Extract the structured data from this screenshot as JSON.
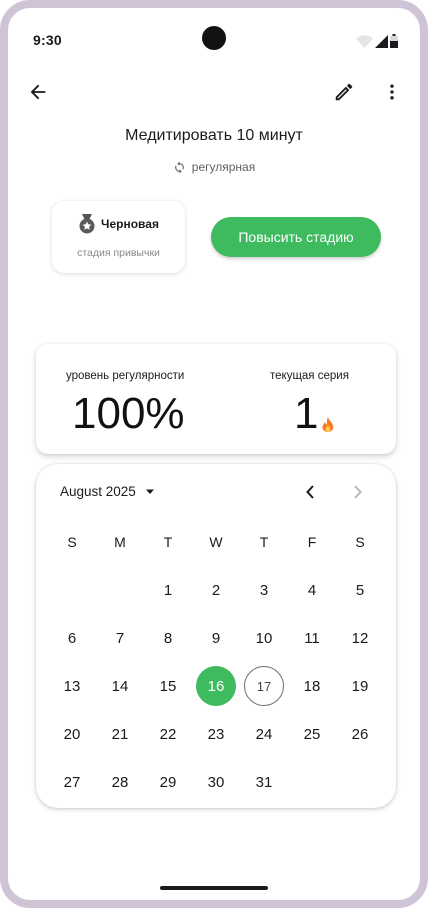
{
  "status_bar": {
    "time": "9:30"
  },
  "habit": {
    "title": "Медитировать 10 минут",
    "frequency": "регулярная"
  },
  "stage": {
    "name": "Черновая",
    "caption": "стадия привычки",
    "promote_label": "Повысить стадию"
  },
  "stats": {
    "regularity_label": "уровень регулярности",
    "regularity_value": "100%",
    "streak_label": "текущая серия",
    "streak_value": "1"
  },
  "calendar": {
    "month": "August 2025",
    "weekdays": [
      "S",
      "M",
      "T",
      "W",
      "T",
      "F",
      "S"
    ],
    "weeks": [
      [
        "",
        "",
        "1",
        "2",
        "3",
        "4",
        "5"
      ],
      [
        "6",
        "7",
        "8",
        "9",
        "10",
        "11",
        "12"
      ],
      [
        "13",
        "14",
        "15",
        "16",
        "17",
        "18",
        "19"
      ],
      [
        "20",
        "21",
        "22",
        "23",
        "24",
        "25",
        "26"
      ],
      [
        "27",
        "28",
        "29",
        "30",
        "31",
        "",
        ""
      ]
    ],
    "selected_day": "16",
    "today_day": "17"
  },
  "colors": {
    "accent": "#3dbb5e",
    "frame": "#cfc4d6",
    "fire": "#f57c1f"
  },
  "icons": [
    "back-arrow-icon",
    "edit-pencil-icon",
    "more-vert-icon",
    "repeat-icon",
    "medal-icon",
    "fire-icon",
    "dropdown-arrow-icon",
    "chevron-left-icon",
    "chevron-right-icon",
    "wifi-icon",
    "signal-icon",
    "battery-icon"
  ]
}
